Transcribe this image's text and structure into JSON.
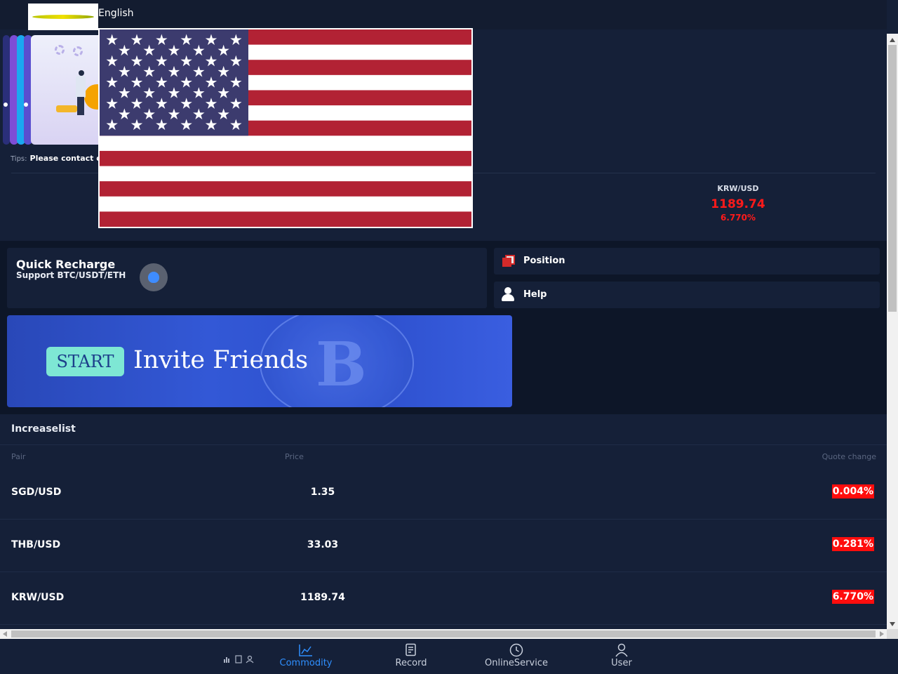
{
  "header": {
    "language": "English"
  },
  "tips": {
    "label": "Tips:",
    "text": "Please contact o"
  },
  "ticker": {
    "pair": "KRW/USD",
    "price": "1189.74",
    "change": "6.770%"
  },
  "quick_recharge": {
    "title": "Quick Recharge",
    "subtitle": "Support BTC/USDT/ETH"
  },
  "actions": {
    "position": "Position",
    "help": "Help"
  },
  "banner": {
    "start": "START",
    "title": "Invite Friends"
  },
  "increase_list": {
    "title": "Increaselist",
    "columns": [
      "Pair",
      "Price",
      "Quote change"
    ],
    "rows": [
      {
        "pair": "SGD/USD",
        "price": "1.35",
        "change": "0.004%"
      },
      {
        "pair": "THB/USD",
        "price": "33.03",
        "change": "0.281%"
      },
      {
        "pair": "KRW/USD",
        "price": "1189.74",
        "change": "6.770%"
      }
    ]
  },
  "nav": {
    "items": [
      {
        "label": "Commodity",
        "icon": "chart-icon",
        "active": true
      },
      {
        "label": "Record",
        "icon": "document-icon",
        "active": false
      },
      {
        "label": "OnlineService",
        "icon": "clock-icon",
        "active": false
      },
      {
        "label": "User",
        "icon": "user-icon",
        "active": false
      }
    ]
  },
  "colors": {
    "background": "#152038",
    "negative": "#ff0d0d",
    "active_nav": "#2f8fff",
    "banner": "#3358d6",
    "start_pill": "#7ee7d4"
  }
}
